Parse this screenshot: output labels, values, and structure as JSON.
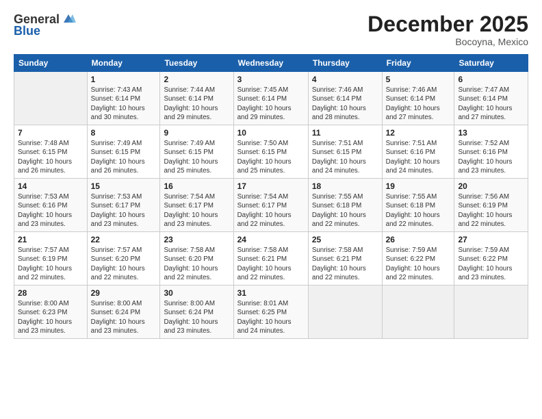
{
  "logo": {
    "general": "General",
    "blue": "Blue"
  },
  "header": {
    "month": "December 2025",
    "location": "Bocoyna, Mexico"
  },
  "days_of_week": [
    "Sunday",
    "Monday",
    "Tuesday",
    "Wednesday",
    "Thursday",
    "Friday",
    "Saturday"
  ],
  "weeks": [
    [
      {
        "day": "",
        "sunrise": "",
        "sunset": "",
        "daylight": ""
      },
      {
        "day": "1",
        "sunrise": "Sunrise: 7:43 AM",
        "sunset": "Sunset: 6:14 PM",
        "daylight": "Daylight: 10 hours and 30 minutes."
      },
      {
        "day": "2",
        "sunrise": "Sunrise: 7:44 AM",
        "sunset": "Sunset: 6:14 PM",
        "daylight": "Daylight: 10 hours and 29 minutes."
      },
      {
        "day": "3",
        "sunrise": "Sunrise: 7:45 AM",
        "sunset": "Sunset: 6:14 PM",
        "daylight": "Daylight: 10 hours and 29 minutes."
      },
      {
        "day": "4",
        "sunrise": "Sunrise: 7:46 AM",
        "sunset": "Sunset: 6:14 PM",
        "daylight": "Daylight: 10 hours and 28 minutes."
      },
      {
        "day": "5",
        "sunrise": "Sunrise: 7:46 AM",
        "sunset": "Sunset: 6:14 PM",
        "daylight": "Daylight: 10 hours and 27 minutes."
      },
      {
        "day": "6",
        "sunrise": "Sunrise: 7:47 AM",
        "sunset": "Sunset: 6:14 PM",
        "daylight": "Daylight: 10 hours and 27 minutes."
      }
    ],
    [
      {
        "day": "7",
        "sunrise": "Sunrise: 7:48 AM",
        "sunset": "Sunset: 6:15 PM",
        "daylight": "Daylight: 10 hours and 26 minutes."
      },
      {
        "day": "8",
        "sunrise": "Sunrise: 7:49 AM",
        "sunset": "Sunset: 6:15 PM",
        "daylight": "Daylight: 10 hours and 26 minutes."
      },
      {
        "day": "9",
        "sunrise": "Sunrise: 7:49 AM",
        "sunset": "Sunset: 6:15 PM",
        "daylight": "Daylight: 10 hours and 25 minutes."
      },
      {
        "day": "10",
        "sunrise": "Sunrise: 7:50 AM",
        "sunset": "Sunset: 6:15 PM",
        "daylight": "Daylight: 10 hours and 25 minutes."
      },
      {
        "day": "11",
        "sunrise": "Sunrise: 7:51 AM",
        "sunset": "Sunset: 6:15 PM",
        "daylight": "Daylight: 10 hours and 24 minutes."
      },
      {
        "day": "12",
        "sunrise": "Sunrise: 7:51 AM",
        "sunset": "Sunset: 6:16 PM",
        "daylight": "Daylight: 10 hours and 24 minutes."
      },
      {
        "day": "13",
        "sunrise": "Sunrise: 7:52 AM",
        "sunset": "Sunset: 6:16 PM",
        "daylight": "Daylight: 10 hours and 23 minutes."
      }
    ],
    [
      {
        "day": "14",
        "sunrise": "Sunrise: 7:53 AM",
        "sunset": "Sunset: 6:16 PM",
        "daylight": "Daylight: 10 hours and 23 minutes."
      },
      {
        "day": "15",
        "sunrise": "Sunrise: 7:53 AM",
        "sunset": "Sunset: 6:17 PM",
        "daylight": "Daylight: 10 hours and 23 minutes."
      },
      {
        "day": "16",
        "sunrise": "Sunrise: 7:54 AM",
        "sunset": "Sunset: 6:17 PM",
        "daylight": "Daylight: 10 hours and 23 minutes."
      },
      {
        "day": "17",
        "sunrise": "Sunrise: 7:54 AM",
        "sunset": "Sunset: 6:17 PM",
        "daylight": "Daylight: 10 hours and 22 minutes."
      },
      {
        "day": "18",
        "sunrise": "Sunrise: 7:55 AM",
        "sunset": "Sunset: 6:18 PM",
        "daylight": "Daylight: 10 hours and 22 minutes."
      },
      {
        "day": "19",
        "sunrise": "Sunrise: 7:55 AM",
        "sunset": "Sunset: 6:18 PM",
        "daylight": "Daylight: 10 hours and 22 minutes."
      },
      {
        "day": "20",
        "sunrise": "Sunrise: 7:56 AM",
        "sunset": "Sunset: 6:19 PM",
        "daylight": "Daylight: 10 hours and 22 minutes."
      }
    ],
    [
      {
        "day": "21",
        "sunrise": "Sunrise: 7:57 AM",
        "sunset": "Sunset: 6:19 PM",
        "daylight": "Daylight: 10 hours and 22 minutes."
      },
      {
        "day": "22",
        "sunrise": "Sunrise: 7:57 AM",
        "sunset": "Sunset: 6:20 PM",
        "daylight": "Daylight: 10 hours and 22 minutes."
      },
      {
        "day": "23",
        "sunrise": "Sunrise: 7:58 AM",
        "sunset": "Sunset: 6:20 PM",
        "daylight": "Daylight: 10 hours and 22 minutes."
      },
      {
        "day": "24",
        "sunrise": "Sunrise: 7:58 AM",
        "sunset": "Sunset: 6:21 PM",
        "daylight": "Daylight: 10 hours and 22 minutes."
      },
      {
        "day": "25",
        "sunrise": "Sunrise: 7:58 AM",
        "sunset": "Sunset: 6:21 PM",
        "daylight": "Daylight: 10 hours and 22 minutes."
      },
      {
        "day": "26",
        "sunrise": "Sunrise: 7:59 AM",
        "sunset": "Sunset: 6:22 PM",
        "daylight": "Daylight: 10 hours and 22 minutes."
      },
      {
        "day": "27",
        "sunrise": "Sunrise: 7:59 AM",
        "sunset": "Sunset: 6:22 PM",
        "daylight": "Daylight: 10 hours and 23 minutes."
      }
    ],
    [
      {
        "day": "28",
        "sunrise": "Sunrise: 8:00 AM",
        "sunset": "Sunset: 6:23 PM",
        "daylight": "Daylight: 10 hours and 23 minutes."
      },
      {
        "day": "29",
        "sunrise": "Sunrise: 8:00 AM",
        "sunset": "Sunset: 6:24 PM",
        "daylight": "Daylight: 10 hours and 23 minutes."
      },
      {
        "day": "30",
        "sunrise": "Sunrise: 8:00 AM",
        "sunset": "Sunset: 6:24 PM",
        "daylight": "Daylight: 10 hours and 23 minutes."
      },
      {
        "day": "31",
        "sunrise": "Sunrise: 8:01 AM",
        "sunset": "Sunset: 6:25 PM",
        "daylight": "Daylight: 10 hours and 24 minutes."
      },
      {
        "day": "",
        "sunrise": "",
        "sunset": "",
        "daylight": ""
      },
      {
        "day": "",
        "sunrise": "",
        "sunset": "",
        "daylight": ""
      },
      {
        "day": "",
        "sunrise": "",
        "sunset": "",
        "daylight": ""
      }
    ]
  ]
}
